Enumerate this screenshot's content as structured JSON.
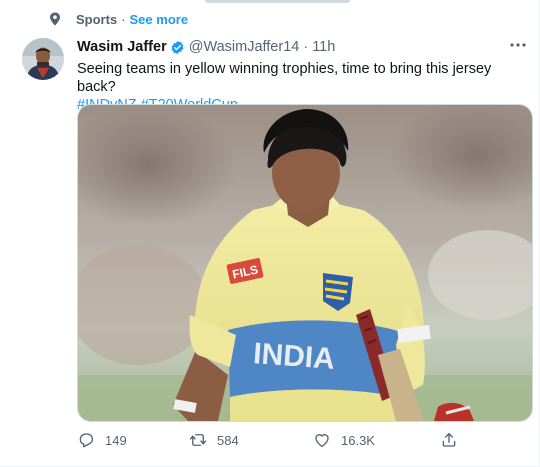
{
  "context": {
    "topic": "Sports",
    "separator": "·",
    "see_more": "See more"
  },
  "tweet": {
    "author_name": "Wasim Jaffer",
    "handle": "@WasimJaffer14",
    "separator": "·",
    "time": "11h",
    "text": "Seeing teams in yellow winning trophies, time to bring this jersey back?",
    "hashtags": [
      "#INDvNZ",
      "#T20WorldCup"
    ],
    "jersey_text": "INDIA",
    "sponsor_text": "FILS"
  },
  "actions": {
    "reply_count": "149",
    "retweet_count": "584",
    "like_count": "16.3K"
  },
  "colors": {
    "accent": "#1d9bf0",
    "muted": "#536471",
    "text": "#0f1419",
    "jersey_yellow": "#ece69a",
    "jersey_blue": "#4f86c6"
  },
  "icons": [
    "pin-icon",
    "verified-badge-icon",
    "more-options-icon",
    "reply-icon",
    "retweet-icon",
    "like-icon",
    "share-icon"
  ]
}
